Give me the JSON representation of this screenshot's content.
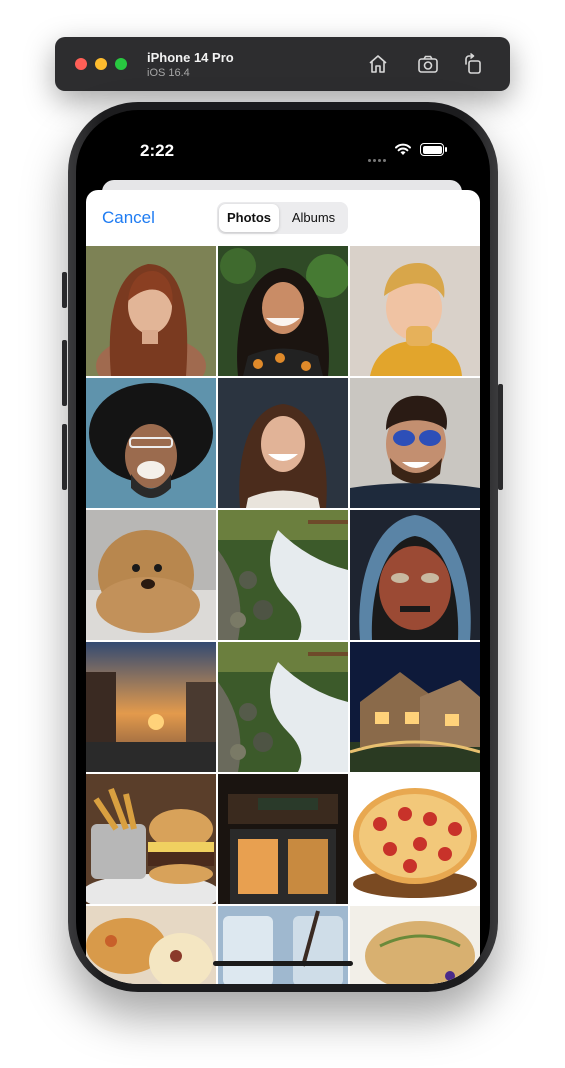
{
  "simulator": {
    "device_name": "iPhone 14 Pro",
    "os_version": "iOS 16.4",
    "icons": [
      "home-icon",
      "screenshot-icon",
      "rotate-icon"
    ]
  },
  "status_bar": {
    "time": "2:22",
    "icons": [
      "signal-dots-icon",
      "wifi-icon",
      "battery-icon"
    ]
  },
  "picker": {
    "cancel_label": "Cancel",
    "tabs": [
      {
        "label": "Photos",
        "selected": true
      },
      {
        "label": "Albums",
        "selected": false
      }
    ]
  },
  "photos": [
    {
      "subject": "woman-red-hair"
    },
    {
      "subject": "woman-floral-dress"
    },
    {
      "subject": "boy-blond"
    },
    {
      "subject": "man-afro-laughing"
    },
    {
      "subject": "woman-smiling"
    },
    {
      "subject": "man-sunglasses"
    },
    {
      "subject": "curly-dog"
    },
    {
      "subject": "river-rocks"
    },
    {
      "subject": "tribal-mask-art"
    },
    {
      "subject": "city-sunset-street"
    },
    {
      "subject": "river-rocks"
    },
    {
      "subject": "house-night"
    },
    {
      "subject": "burger-fries"
    },
    {
      "subject": "restaurant-facade"
    },
    {
      "subject": "pepperoni-pizza"
    },
    {
      "subject": "fried-food-plate"
    },
    {
      "subject": "iced-drinks"
    },
    {
      "subject": "fish-dish"
    }
  ],
  "colors": {
    "accent": "#1f7cf2",
    "toolbar_bg": "#2d2d2f"
  }
}
